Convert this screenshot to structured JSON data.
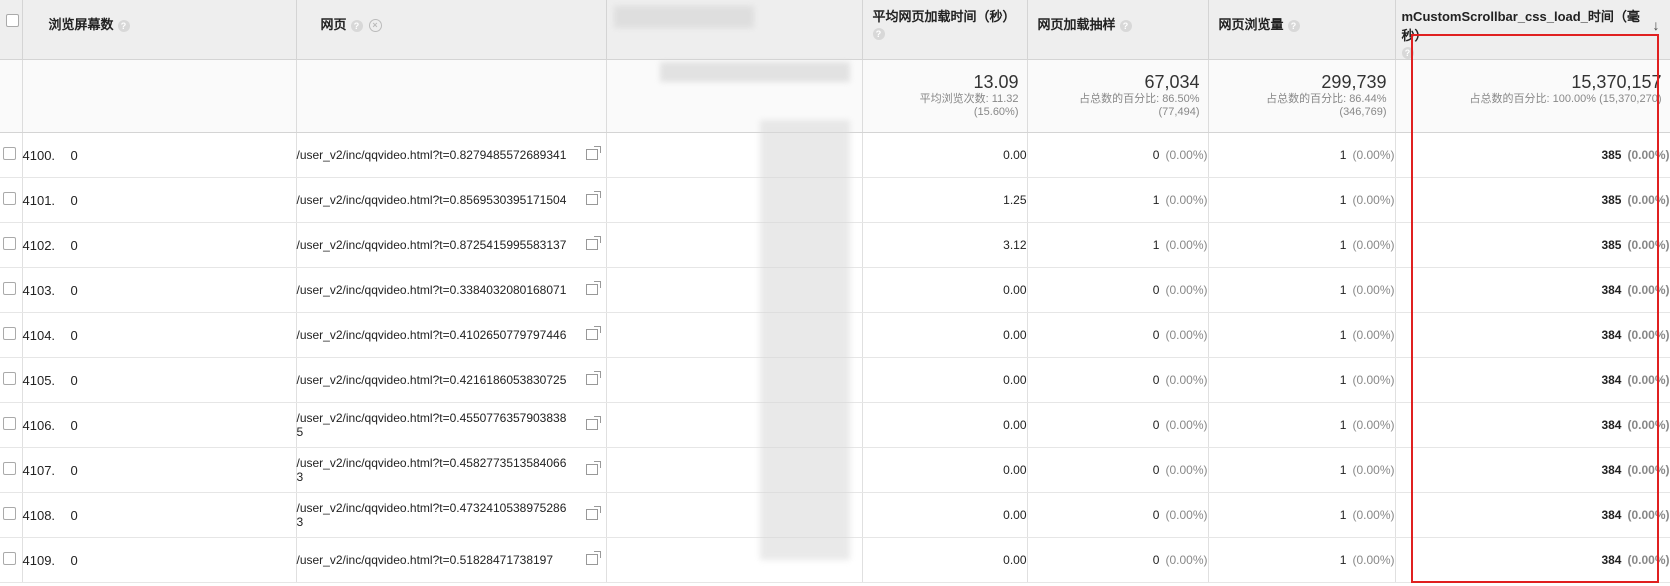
{
  "headers": {
    "screens": "浏览屏幕数",
    "page": "网页",
    "load_time": "平均网页加载时间（秒）",
    "load_sample": "网页加载抽样",
    "pageviews": "网页浏览量",
    "metric": "mCustomScrollbar_css_load_时间（毫秒）"
  },
  "totals": {
    "load_time": {
      "big": "13.09",
      "sub1": "平均浏览次数: 11.32",
      "sub2": "(15.60%)"
    },
    "load_sample": {
      "big": "67,034",
      "sub1": "占总数的百分比: 86.50%",
      "sub2": "(77,494)"
    },
    "pageviews": {
      "big": "299,739",
      "sub1": "占总数的百分比: 86.44%",
      "sub2": "(346,769)"
    },
    "metric": {
      "big": "15,370,157",
      "sub1": "占总数的百分比: 100.00% (15,370,270)"
    }
  },
  "rows": [
    {
      "idx": "4100.",
      "screens": "0",
      "page": "/user_v2/inc/qqvideo.html?t=0.8279485572689341",
      "lt": "0.00",
      "samp": "0",
      "samp_pct": "(0.00%)",
      "pv": "1",
      "pv_pct": "(0.00%)",
      "m": "385",
      "m_pct": "(0.00%)"
    },
    {
      "idx": "4101.",
      "screens": "0",
      "page": "/user_v2/inc/qqvideo.html?t=0.8569530395171504",
      "lt": "1.25",
      "samp": "1",
      "samp_pct": "(0.00%)",
      "pv": "1",
      "pv_pct": "(0.00%)",
      "m": "385",
      "m_pct": "(0.00%)"
    },
    {
      "idx": "4102.",
      "screens": "0",
      "page": "/user_v2/inc/qqvideo.html?t=0.8725415995583137",
      "lt": "3.12",
      "samp": "1",
      "samp_pct": "(0.00%)",
      "pv": "1",
      "pv_pct": "(0.00%)",
      "m": "385",
      "m_pct": "(0.00%)"
    },
    {
      "idx": "4103.",
      "screens": "0",
      "page": "/user_v2/inc/qqvideo.html?t=0.3384032080168071",
      "lt": "0.00",
      "samp": "0",
      "samp_pct": "(0.00%)",
      "pv": "1",
      "pv_pct": "(0.00%)",
      "m": "384",
      "m_pct": "(0.00%)"
    },
    {
      "idx": "4104.",
      "screens": "0",
      "page": "/user_v2/inc/qqvideo.html?t=0.4102650779797446",
      "lt": "0.00",
      "samp": "0",
      "samp_pct": "(0.00%)",
      "pv": "1",
      "pv_pct": "(0.00%)",
      "m": "384",
      "m_pct": "(0.00%)"
    },
    {
      "idx": "4105.",
      "screens": "0",
      "page": "/user_v2/inc/qqvideo.html?t=0.4216186053830725",
      "lt": "0.00",
      "samp": "0",
      "samp_pct": "(0.00%)",
      "pv": "1",
      "pv_pct": "(0.00%)",
      "m": "384",
      "m_pct": "(0.00%)"
    },
    {
      "idx": "4106.",
      "screens": "0",
      "page": "/user_v2/inc/qqvideo.html?t=0.45507763579038385",
      "lt": "0.00",
      "samp": "0",
      "samp_pct": "(0.00%)",
      "pv": "1",
      "pv_pct": "(0.00%)",
      "m": "384",
      "m_pct": "(0.00%)"
    },
    {
      "idx": "4107.",
      "screens": "0",
      "page": "/user_v2/inc/qqvideo.html?t=0.45827735135840663",
      "lt": "0.00",
      "samp": "0",
      "samp_pct": "(0.00%)",
      "pv": "1",
      "pv_pct": "(0.00%)",
      "m": "384",
      "m_pct": "(0.00%)"
    },
    {
      "idx": "4108.",
      "screens": "0",
      "page": "/user_v2/inc/qqvideo.html?t=0.47324105389752863",
      "lt": "0.00",
      "samp": "0",
      "samp_pct": "(0.00%)",
      "pv": "1",
      "pv_pct": "(0.00%)",
      "m": "384",
      "m_pct": "(0.00%)"
    },
    {
      "idx": "4109.",
      "screens": "0",
      "page": "/user_v2/inc/qqvideo.html?t=0.51828471738197",
      "lt": "0.00",
      "samp": "0",
      "samp_pct": "(0.00%)",
      "pv": "1",
      "pv_pct": "(0.00%)",
      "m": "384",
      "m_pct": "(0.00%)"
    }
  ],
  "icons": {
    "help": "help-icon",
    "remove": "remove-dimension-icon",
    "sort": "sort-desc-icon",
    "external": "external-link-icon"
  },
  "colors": {
    "highlight": "#e02020",
    "header_bg": "#eeeeee"
  }
}
